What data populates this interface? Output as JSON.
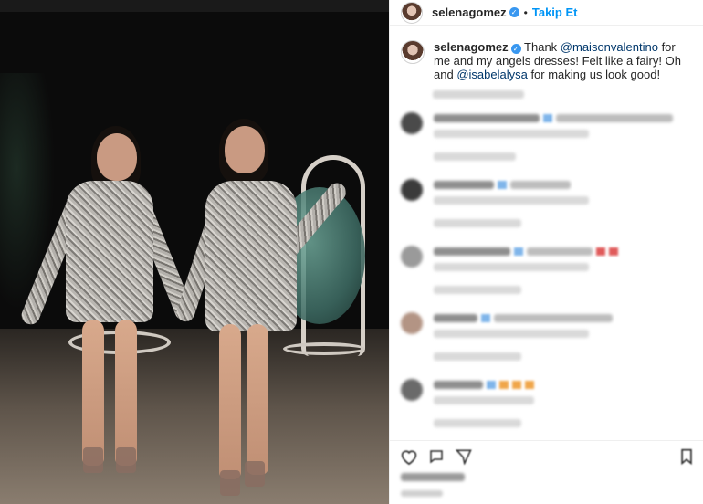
{
  "header": {
    "username": "selenagomez",
    "separator": "•",
    "follow_label": "Takip Et"
  },
  "caption": {
    "username": "selenagomez",
    "text_1": "Thank ",
    "mention_1": "@maisonvalentino",
    "text_2": " for me and my angels dresses! Felt like a fairy! Oh and ",
    "mention_2": "@isabelalysa",
    "text_3": " for making us look good!"
  },
  "icons": {
    "verified": "verified-badge-icon",
    "like": "heart-icon",
    "comment": "comment-icon",
    "share": "share-icon",
    "save": "bookmark-icon"
  },
  "colors": {
    "link": "#0095f6",
    "mention": "#00376b",
    "verified": "#3897f0"
  }
}
